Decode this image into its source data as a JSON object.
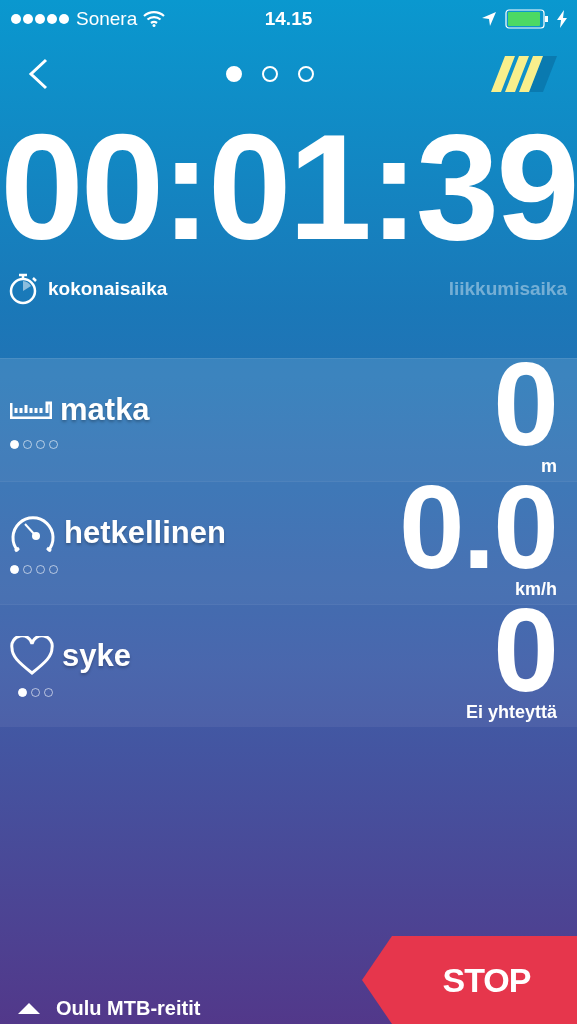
{
  "status_bar": {
    "carrier": "Sonera",
    "time": "14.15"
  },
  "pager": [
    {
      "selected": true
    },
    {
      "selected": false
    },
    {
      "selected": false
    }
  ],
  "timer": {
    "value": "00:01:39",
    "modes": [
      {
        "label": "kokonaisaika",
        "selected": true
      },
      {
        "label": "liikkumisaika",
        "selected": false
      }
    ]
  },
  "metrics": [
    {
      "kind": "distance",
      "label": "matka",
      "value": "0",
      "unit": "m",
      "pages": [
        {
          "selected": true
        },
        {
          "selected": false
        },
        {
          "selected": false
        },
        {
          "selected": false
        }
      ]
    },
    {
      "kind": "speed",
      "label": "hetkellinen",
      "value": "0.0",
      "unit": "km/h",
      "pages": [
        {
          "selected": true
        },
        {
          "selected": false
        },
        {
          "selected": false
        },
        {
          "selected": false
        }
      ]
    },
    {
      "kind": "heart",
      "label": "syke",
      "value": "0",
      "unit": "Ei yhteyttä",
      "pages": [
        {
          "selected": true
        },
        {
          "selected": false
        },
        {
          "selected": false
        }
      ]
    }
  ],
  "route": {
    "label": "Oulu MTB-reitit"
  },
  "stop_button": {
    "label": "STOP"
  }
}
